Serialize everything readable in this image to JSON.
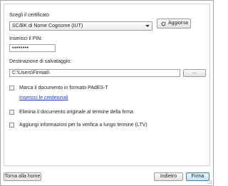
{
  "certificate": {
    "label": "Scegli il certificato",
    "selected": "SC/BK di Nome Cognome (IUT)",
    "refresh_label": "Aggiorna"
  },
  "pin": {
    "label": "Inserisci il PIN:",
    "masked_value": "••••••••"
  },
  "destination": {
    "label": "Destinazione di salvataggio:",
    "path": "C:\\Users\\Firmati\\",
    "browse_label": "..."
  },
  "options": {
    "pades_label": "Marca il documento in formato PAdES-T",
    "credentials_link": "Inserisci le credenziali",
    "delete_original_label": "Elimina il documento originale al termine della firma",
    "ltv_label": "Aggiungi informazioni per la verifica a lungo termine (LTV)"
  },
  "footer": {
    "home_label": "Torna alla home",
    "back_label": "Indietro",
    "sign_label": "Firma"
  },
  "icons": {
    "refresh": "refresh-icon",
    "dropdown": "chevron-down-icon"
  },
  "colors": {
    "link": "#1a3fc4",
    "primary_button_border": "#3c7fb1"
  }
}
